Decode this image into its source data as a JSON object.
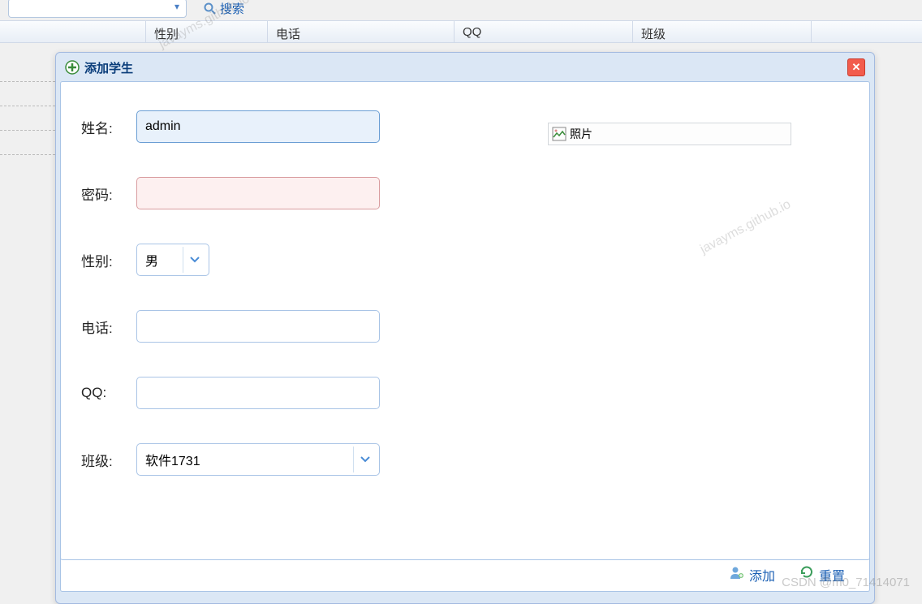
{
  "top": {
    "search_label": "搜索"
  },
  "table_headers": [
    "",
    "性别",
    "电话",
    "QQ",
    "班级"
  ],
  "dialog": {
    "title": "添加学生",
    "labels": {
      "name": "姓名:",
      "password": "密码:",
      "gender": "性别:",
      "phone": "电话:",
      "qq": "QQ:",
      "class": "班级:"
    },
    "values": {
      "name": "admin",
      "password": "",
      "gender": "男",
      "phone": "",
      "qq": "",
      "class": "软件1731"
    },
    "photo_label": "照片",
    "buttons": {
      "add": "添加",
      "reset": "重置"
    }
  },
  "watermarks": {
    "url": "javayms.github.io",
    "csdn": "CSDN @m0_71414071"
  }
}
